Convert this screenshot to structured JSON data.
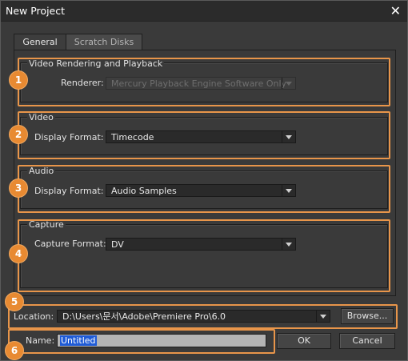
{
  "window": {
    "title": "New Project"
  },
  "tabs": [
    {
      "label": "General",
      "active": true
    },
    {
      "label": "Scratch Disks",
      "active": false
    }
  ],
  "groups": {
    "video_rendering": {
      "title": "Video Rendering and Playback",
      "renderer_label": "Renderer:",
      "renderer_value": "Mercury Playback Engine Software Only",
      "badge": "1"
    },
    "video": {
      "title": "Video",
      "display_format_label": "Display Format:",
      "display_format_value": "Timecode",
      "badge": "2"
    },
    "audio": {
      "title": "Audio",
      "display_format_label": "Display Format:",
      "display_format_value": "Audio Samples",
      "badge": "3"
    },
    "capture": {
      "title": "Capture",
      "capture_format_label": "Capture Format:",
      "capture_format_value": "DV",
      "badge": "4"
    }
  },
  "location": {
    "label": "Location:",
    "value": "D:\\Users\\문서\\Adobe\\Premiere Pro\\6.0",
    "browse_label": "Browse...",
    "badge": "5"
  },
  "name": {
    "label": "Name:",
    "value": "Untitled",
    "badge": "6"
  },
  "buttons": {
    "ok": "OK",
    "cancel": "Cancel"
  },
  "colors": {
    "highlight": "#e8954a",
    "badge": "#e88a32",
    "selection": "#1f5bd6"
  }
}
